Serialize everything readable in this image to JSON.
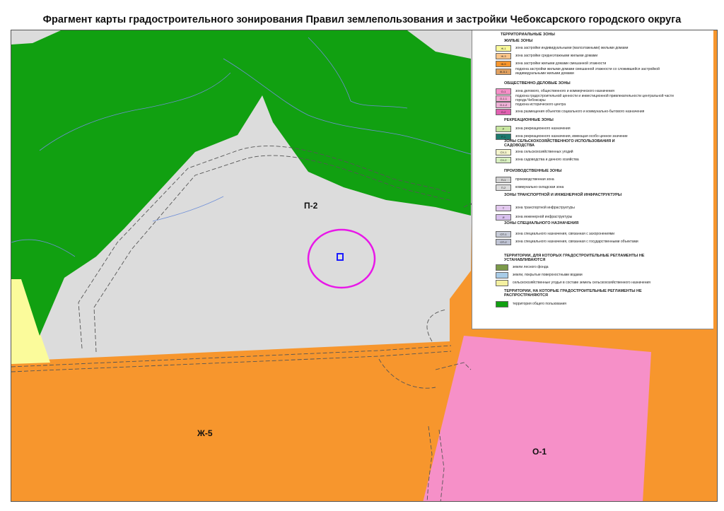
{
  "title": "Фрагмент карты градостроительного зонирования Правил землепользования и застройки Чебоксарского городского округа",
  "map": {
    "labels": {
      "p2": "П-2",
      "zh5": "Ж-5",
      "o1": "О-1"
    },
    "colors": {
      "industrial": "#dcdcdc",
      "public_use_green": "#11a011",
      "residential_mixed": "#f7962d",
      "business": "#f690c8",
      "agricultural_yellow": "#fbfb9b",
      "marker_circle": "#e817e8",
      "marker_square": "#1a1aff"
    }
  },
  "legend": {
    "title": "ТЕРРИТОРИАЛЬНЫЕ ЗОНЫ",
    "groups": [
      {
        "heading": "ЖИЛЫЕ ЗОНЫ",
        "items": [
          {
            "code": "Ж-1",
            "text": "зона застройки индивидуальными (малоэтажными) жилыми домами",
            "color": "#fbfb9b"
          },
          {
            "code": "Ж-3",
            "text": "зона застройки среднеэтажными жилыми домами",
            "color": "#fbc58a"
          },
          {
            "code": "Ж-5",
            "text": "зона застройки жилыми домами смешанной этажности",
            "color": "#f7962d"
          },
          {
            "code": "Ж-5.1",
            "text": "подзона застройки жилыми домами смешанной этажности со сложившейся застройкой индивидуальными жилыми домами",
            "color": "#e0a060"
          }
        ]
      },
      {
        "heading": "ОБЩЕСТВЕННО-ДЕЛОВЫЕ ЗОНЫ",
        "items": [
          {
            "code": "О-1",
            "text": "зона делового, общественного и коммерческого назначения",
            "color": "#f690c8"
          },
          {
            "code": "О-1.1",
            "text": "подзона градостроительной ценности и инвестиционной привлекательности центральной части города Чебоксары",
            "color": "#f4a8d2"
          },
          {
            "code": "О-1.2",
            "text": "подзона исторического центра",
            "color": "#eeb0d6"
          },
          {
            "code": "О-2",
            "text": "зона размещения объектов социального и коммунально-бытового назначения",
            "color": "#e060b0"
          }
        ]
      },
      {
        "heading": "РЕКРЕАЦИОННЫЕ ЗОНЫ",
        "items": [
          {
            "code": "Р",
            "text": "зона рекреационного назначения",
            "color": "#c8e6a0"
          },
          {
            "code": "Р-1",
            "text": "зона рекреационного назначения, имеющая особо ценное значение",
            "color": "#1e7a6e"
          }
        ]
      },
      {
        "heading": "ЗОНЫ СЕЛЬСКОХОЗЯЙСТВЕННОГО ИСПОЛЬЗОВАНИЯ И САДОВОДСТВА",
        "items": [
          {
            "code": "СХ-1",
            "text": "зона сельскохозяйственных угодий",
            "color": "#f4f4cc"
          },
          {
            "code": "СХ-2",
            "text": "зона садоводства и дачного хозяйства",
            "color": "#d8f0c0"
          }
        ]
      },
      {
        "heading": "ПРОИЗВОДСТВЕННЫЕ ЗОНЫ",
        "items": [
          {
            "code": "П-1",
            "text": "производственная зона",
            "color": "#d0d0d0"
          },
          {
            "code": "П-2",
            "text": "коммунально-складская зона",
            "color": "#dcdcdc"
          }
        ]
      },
      {
        "heading": "ЗОНЫ ТРАНСПОРТНОЙ И ИНЖЕНЕРНОЙ ИНФРАСТРУКТУРЫ",
        "items": [
          {
            "code": "Т",
            "text": "зона транспортной инфраструктуры",
            "color": "#e2c8ee"
          },
          {
            "code": "И",
            "text": "зона инженерной инфраструктуры",
            "color": "#d8c0ee"
          }
        ]
      },
      {
        "heading": "ЗОНЫ СПЕЦИАЛЬНОГО НАЗНАЧЕНИЯ",
        "items": [
          {
            "code": "СП-1",
            "text": "зона специального назначения, связанная с захоронениями",
            "color": "#c8ccd8"
          },
          {
            "code": "СП-2",
            "text": "зона специального назначения, связанная с государственными объектами",
            "color": "#c0c4d4"
          }
        ]
      },
      {
        "heading": "ТЕРРИТОРИИ, ДЛЯ КОТОРЫХ ГРАДОСТРОИТЕЛЬНЫЕ РЕГЛАМЕНТЫ НЕ УСТАНАВЛИВАЮТСЯ",
        "items": [
          {
            "code": "",
            "text": "земли лесного фонда",
            "color": "#7c9a4a"
          },
          {
            "code": "",
            "text": "земли, покрытые поверхностными водами",
            "color": "#a8cce8"
          },
          {
            "code": "",
            "text": "сельскохозяйственные угодья в составе земель сельскохозяйственного назначения",
            "color": "#f4f0a0"
          }
        ]
      },
      {
        "heading": "ТЕРРИТОРИИ, НА КОТОРЫЕ ГРАДОСТРОИТЕЛЬНЫЕ РЕГЛАМЕНТЫ НЕ РАСПРОСТРАНЯЮТСЯ",
        "items": [
          {
            "code": "",
            "text": "территория общего пользования",
            "color": "#11a011"
          }
        ]
      }
    ]
  }
}
